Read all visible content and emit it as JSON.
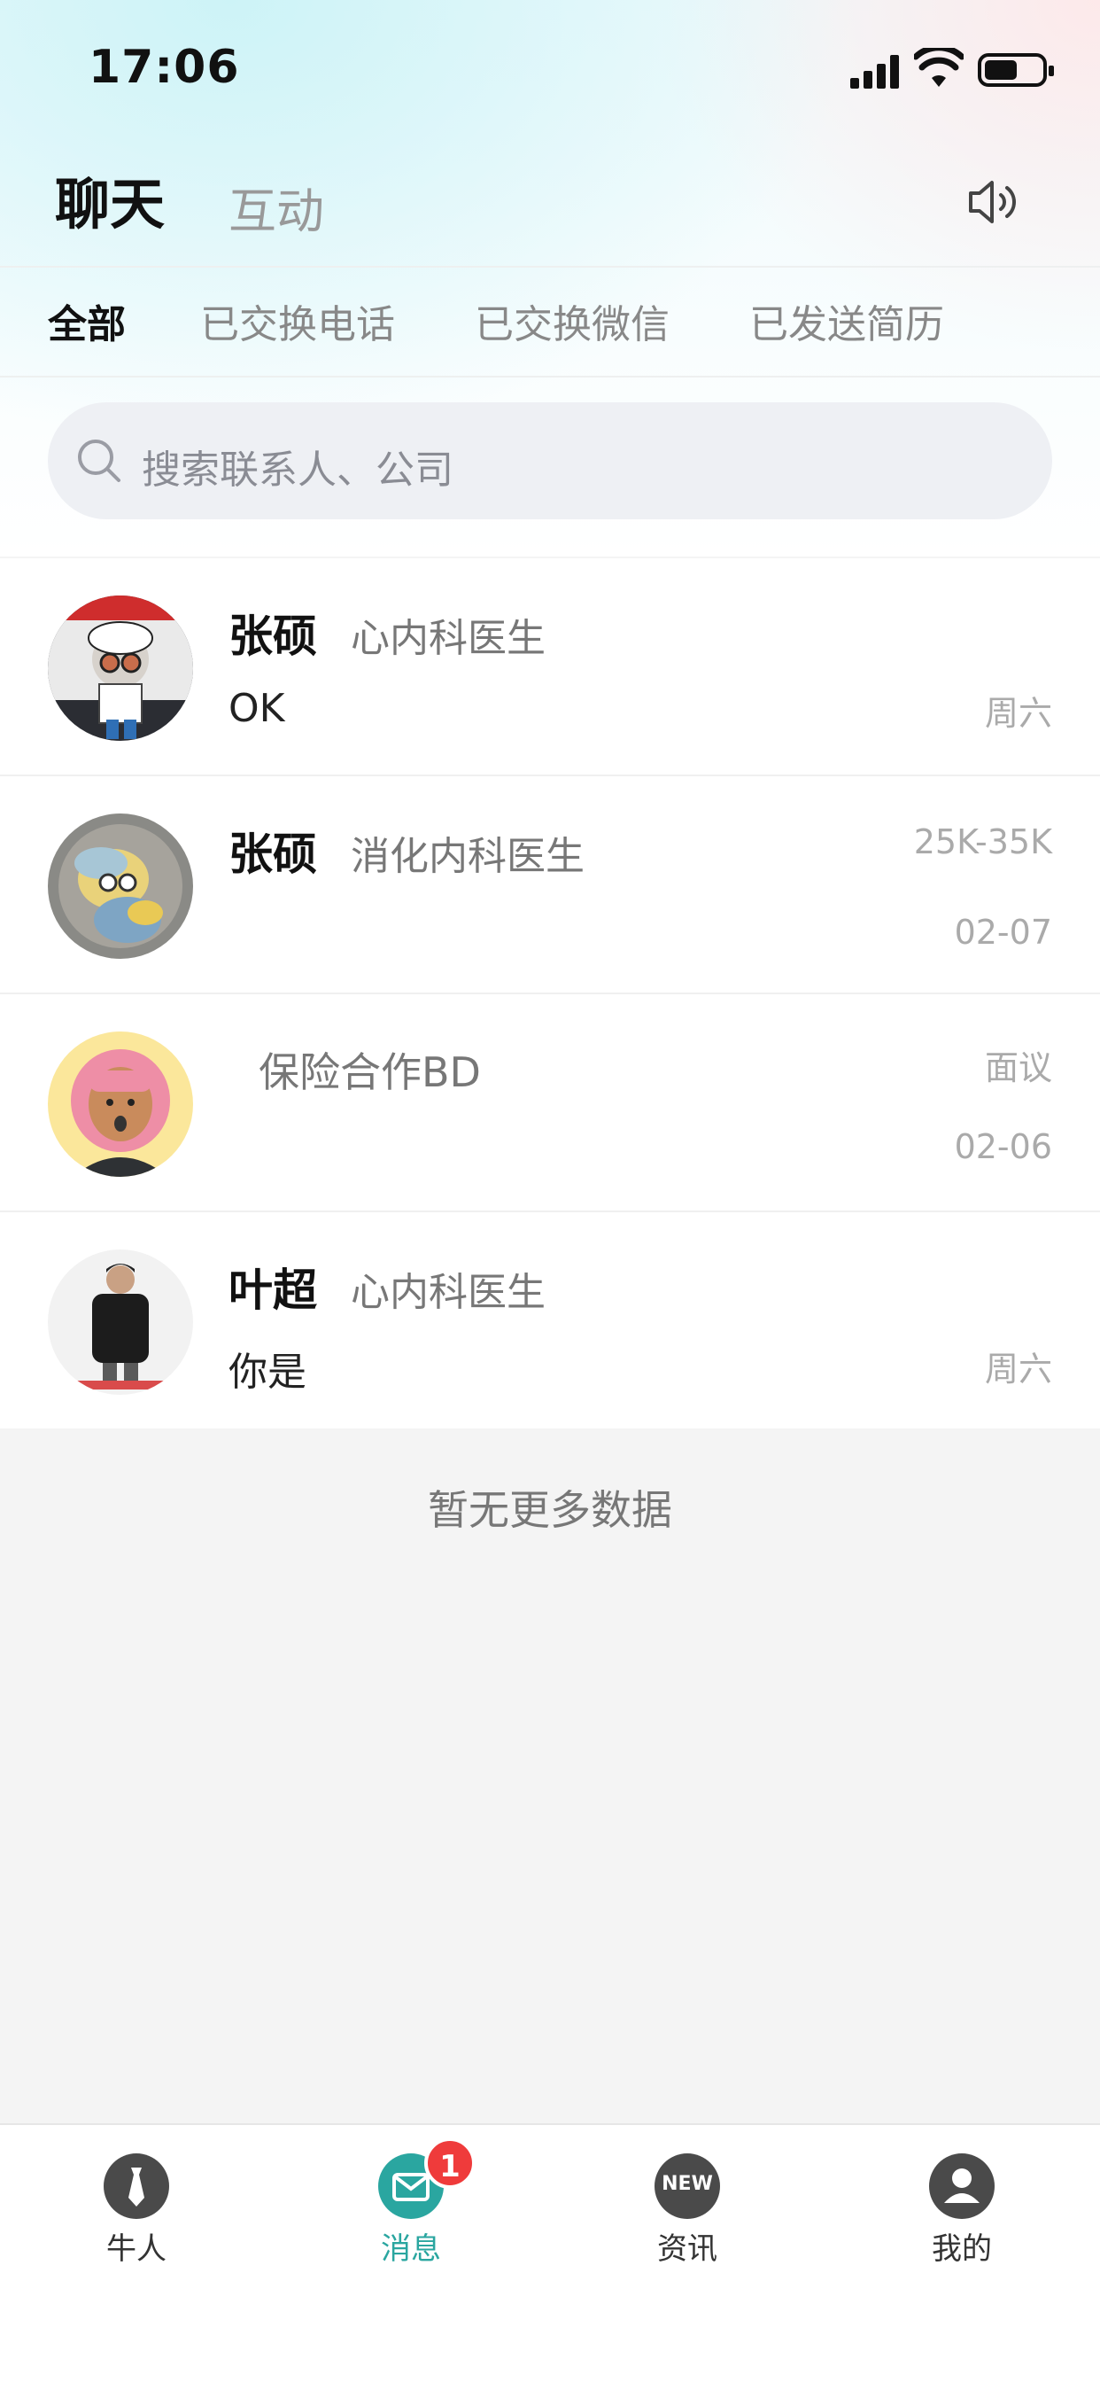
{
  "status_bar": {
    "time": "17:06"
  },
  "header": {
    "tabs": [
      {
        "label": "聊天",
        "active": true
      },
      {
        "label": "互动",
        "active": false
      }
    ],
    "speaker_icon": "speaker-icon"
  },
  "filters": [
    {
      "label": "全部",
      "active": true
    },
    {
      "label": "已交换电话",
      "active": false
    },
    {
      "label": "已交换微信",
      "active": false
    },
    {
      "label": "已发送简历",
      "active": false
    }
  ],
  "search": {
    "placeholder": "搜索联系人、公司"
  },
  "conversations": [
    {
      "name": "张硕",
      "role": "心内科医生",
      "message": "OK",
      "salary": "",
      "date": "周六"
    },
    {
      "name": "张硕",
      "role": "消化内科医生",
      "message": "",
      "salary": "25K-35K",
      "date": "02-07"
    },
    {
      "name": "",
      "role": "保险合作BD",
      "message": "",
      "salary": "面议",
      "date": "02-06"
    },
    {
      "name": "叶超",
      "role": "心内科医生",
      "message": "你是",
      "salary": "",
      "date": "周六"
    }
  ],
  "footer_text": "暂无更多数据",
  "tabbar": {
    "items": [
      {
        "label": "牛人",
        "icon": "tie-icon",
        "active": false
      },
      {
        "label": "消息",
        "icon": "mail-icon",
        "active": true,
        "badge": "1"
      },
      {
        "label": "资讯",
        "icon": "new-icon",
        "active": false,
        "icon_text": "NEW"
      },
      {
        "label": "我的",
        "icon": "user-icon",
        "active": false
      }
    ]
  },
  "colors": {
    "accent": "#2aa6a0",
    "badge": "#ef3b3b"
  }
}
